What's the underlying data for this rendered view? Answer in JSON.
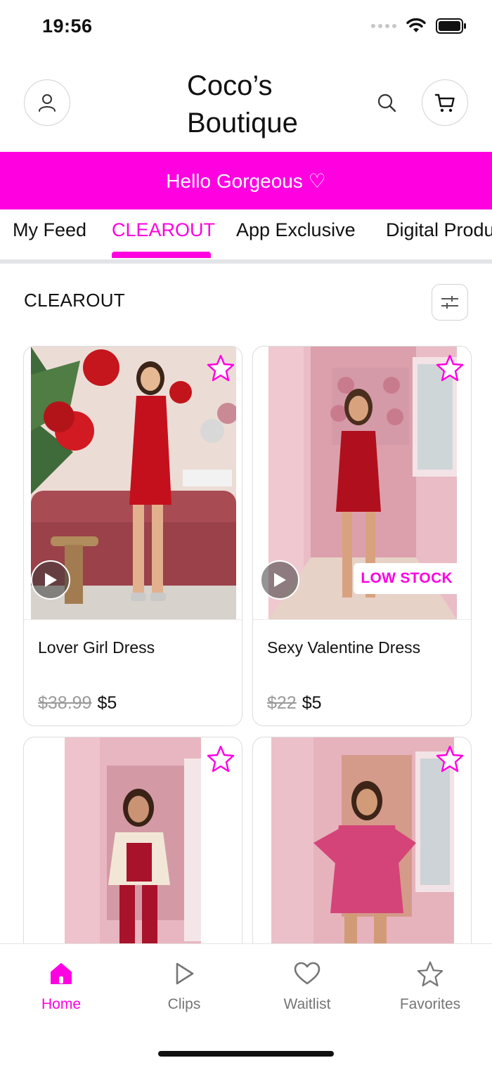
{
  "status_bar": {
    "time": "19:56"
  },
  "header": {
    "brand": "Coco’s Boutique"
  },
  "banner": {
    "text": "Hello Gorgeous ♡"
  },
  "tabs": [
    {
      "label": "My Feed",
      "active": false
    },
    {
      "label": "CLEAROUT",
      "active": true
    },
    {
      "label": "App Exclusive",
      "active": false
    },
    {
      "label": "Digital Products",
      "active": false
    }
  ],
  "section": {
    "title": "CLEAROUT"
  },
  "products": [
    {
      "name": "Lover Girl Dress",
      "old_price": "$38.99",
      "price": "$5",
      "has_video": true,
      "badge": ""
    },
    {
      "name": "Sexy Valentine Dress",
      "old_price": "$22",
      "price": "$5",
      "has_video": true,
      "badge": "LOW STOCK"
    },
    {
      "name": "",
      "old_price": "",
      "price": "",
      "has_video": false,
      "badge": ""
    },
    {
      "name": "",
      "old_price": "",
      "price": "",
      "has_video": false,
      "badge": ""
    }
  ],
  "bottom_nav": [
    {
      "label": "Home",
      "icon": "home-icon",
      "active": true
    },
    {
      "label": "Clips",
      "icon": "play-icon",
      "active": false
    },
    {
      "label": "Waitlist",
      "icon": "heart-icon",
      "active": false
    },
    {
      "label": "Favorites",
      "icon": "star-icon",
      "active": false
    }
  ],
  "colors": {
    "accent": "#ff00e1",
    "muted": "#757575",
    "divider": "#e2e4e8"
  }
}
